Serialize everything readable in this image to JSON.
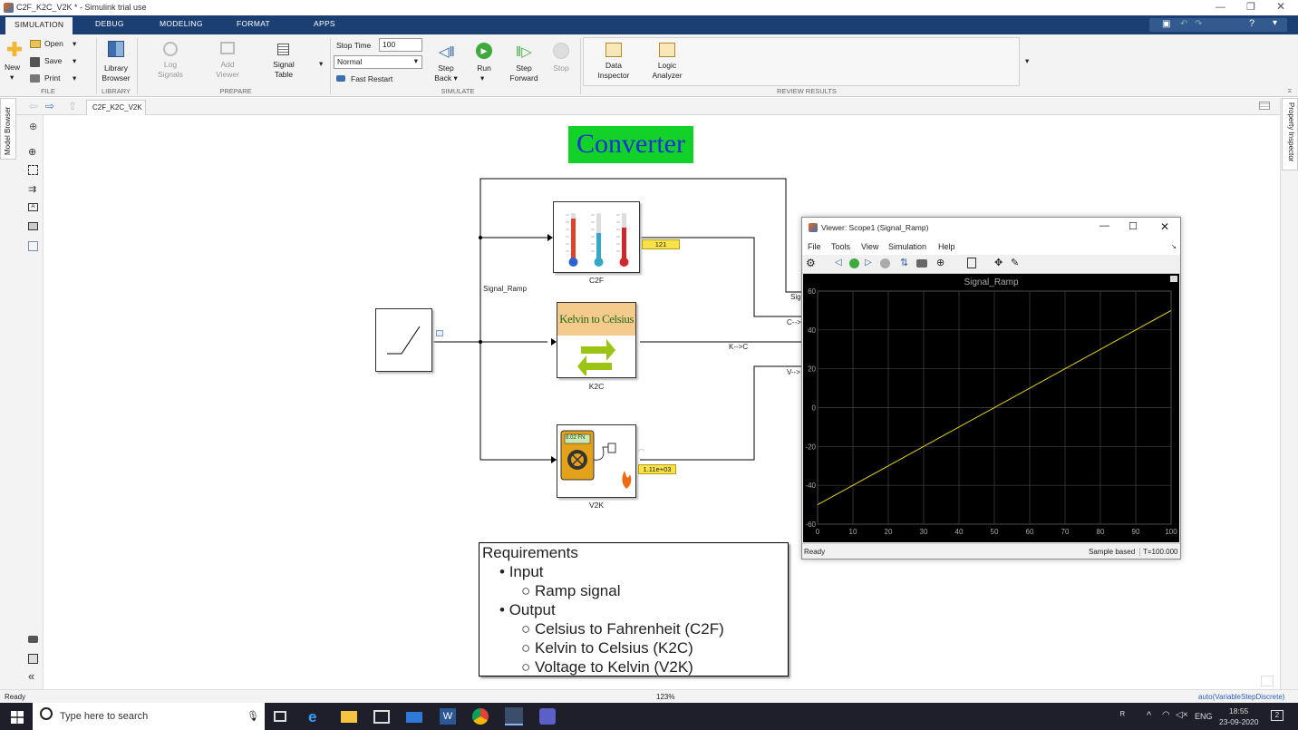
{
  "window": {
    "title": "C2F_K2C_V2K * - Simulink trial use"
  },
  "tabs": [
    "SIMULATION",
    "DEBUG",
    "MODELING",
    "FORMAT",
    "APPS"
  ],
  "ribbon": {
    "new": "New",
    "open": "Open",
    "save": "Save",
    "print": "Print",
    "file": "FILE",
    "library_browser": [
      "Library",
      "Browser"
    ],
    "library": "LIBRARY",
    "log_signals": [
      "Log",
      "Signals"
    ],
    "add_viewer": [
      "Add",
      "Viewer"
    ],
    "signal_table": [
      "Signal",
      "Table"
    ],
    "prepare": "PREPARE",
    "stop_time_label": "Stop Time",
    "stop_time_value": "100",
    "mode": "Normal",
    "fast_restart": "Fast Restart",
    "step_back": [
      "Step",
      "Back"
    ],
    "run": "Run",
    "step_forward": [
      "Step",
      "Forward"
    ],
    "stop": "Stop",
    "simulate": "SIMULATE",
    "data_inspector": [
      "Data",
      "Inspector"
    ],
    "logic_analyzer": [
      "Logic",
      "Analyzer"
    ],
    "review_results": "REVIEW RESULTS"
  },
  "nav": {
    "model_tab": "C2F_K2C_V2K"
  },
  "side": {
    "model_browser": "Model Browser",
    "property_inspector": "Property Inspector"
  },
  "model": {
    "title": "Converter",
    "signal_label": "Signal_Ramp",
    "blocks": {
      "c2f": "C2F",
      "k2c": "K2C",
      "v2k": "V2K",
      "k2c_text": "Kelvin to Celsius"
    },
    "displays": {
      "c2f_value": "121",
      "v2k_value": "1.11e+03",
      "multimeter_value": "8.02 FN"
    },
    "wire_labels": {
      "k2c": "K-->C",
      "c2f": "C-->",
      "v2k": "V-->",
      "sig": "Sig"
    }
  },
  "requirements": {
    "title": "Requirements",
    "items": [
      {
        "label": "Input",
        "sub": [
          "Ramp signal"
        ]
      },
      {
        "label": "Output",
        "sub": [
          "Celsius to Fahrenheit (C2F)",
          "Kelvin to Celsius (K2C)",
          "Voltage to Kelvin (V2K)"
        ]
      }
    ]
  },
  "viewer": {
    "title": "Viewer: Scope1 (Signal_Ramp)",
    "menu": [
      "File",
      "Tools",
      "View",
      "Simulation",
      "Help"
    ],
    "plot_title": "Signal_Ramp",
    "status_left": "Ready",
    "status_mode": "Sample based",
    "status_time": "T=100.000"
  },
  "chart_data": {
    "type": "line",
    "title": "Signal_Ramp",
    "xlim": [
      0,
      100
    ],
    "ylim": [
      -60,
      60
    ],
    "xticks": [
      0,
      10,
      20,
      30,
      40,
      50,
      60,
      70,
      80,
      90,
      100
    ],
    "yticks": [
      60,
      40,
      20,
      0,
      -20,
      -40,
      -60
    ],
    "grid": true,
    "series": [
      {
        "x": [
          0,
          100
        ],
        "y": [
          -50,
          50
        ],
        "color": "#e6d21a"
      }
    ],
    "bg": "#000000"
  },
  "status": {
    "left": "Ready",
    "zoom": "123%",
    "solver": "auto(VariableStepDiscrete)"
  },
  "taskbar": {
    "search": "Type here to search",
    "lang": "ENG",
    "time": "18:55",
    "date": "23-09-2020",
    "notif": "2"
  }
}
